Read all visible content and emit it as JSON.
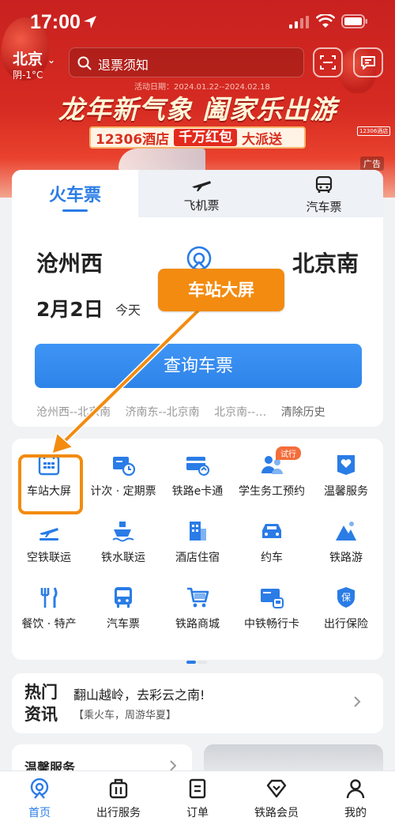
{
  "status_bar": {
    "time": "17:00"
  },
  "header": {
    "city": "北京",
    "weather": "阴-1°C",
    "search_text": "退票须知"
  },
  "banner": {
    "activity_date": "活动日期：2024.01.22--2024.02.18",
    "slogan": "龙年新气象 阖家乐出游",
    "promo_part1": "12306酒店",
    "promo_part2": "千万红包",
    "promo_part3": "大派送",
    "hotel_tag": "12306酒店",
    "ad_tag": "广告"
  },
  "ticket": {
    "tabs": [
      {
        "label": "火车票"
      },
      {
        "label": "飞机票"
      },
      {
        "label": "汽车票"
      }
    ],
    "from": "沧州西",
    "to": "北京南",
    "date": "2月2日",
    "date_relative": "今天",
    "query_button": "查询车票",
    "history": [
      "沧州西--北京南",
      "济南东--北京南",
      "北京南--…"
    ],
    "clear_history": "清除历史"
  },
  "callout": {
    "text": "车站大屏"
  },
  "services": [
    {
      "label": "车站大屏",
      "icon": "calendar-grid-icon"
    },
    {
      "label": "计次 · 定期票",
      "icon": "ticket-clock-icon"
    },
    {
      "label": "铁路e卡通",
      "icon": "card-icon"
    },
    {
      "label": "学生务工预约",
      "icon": "people-icon",
      "badge": "试行"
    },
    {
      "label": "温馨服务",
      "icon": "heart-icon"
    },
    {
      "label": "空铁联运",
      "icon": "plane-train-icon"
    },
    {
      "label": "铁水联运",
      "icon": "ship-icon"
    },
    {
      "label": "酒店住宿",
      "icon": "hotel-icon"
    },
    {
      "label": "约车",
      "icon": "car-icon"
    },
    {
      "label": "铁路游",
      "icon": "mountain-icon"
    },
    {
      "label": "餐饮 · 特产",
      "icon": "cutlery-icon"
    },
    {
      "label": "汽车票",
      "icon": "bus-icon"
    },
    {
      "label": "铁路商城",
      "icon": "cart-icon"
    },
    {
      "label": "中铁畅行卡",
      "icon": "rail-card-icon"
    },
    {
      "label": "出行保险",
      "icon": "shield-icon"
    }
  ],
  "news": {
    "tag_line1": "热门",
    "tag_line2": "资讯",
    "title": "翻山越岭，去彩云之南!",
    "subtitle": "【乘火车，周游华夏】"
  },
  "care": {
    "label": "温馨服务"
  },
  "bottom_nav": [
    {
      "label": "首页",
      "active": true
    },
    {
      "label": "出行服务"
    },
    {
      "label": "订单"
    },
    {
      "label": "铁路会员"
    },
    {
      "label": "我的"
    }
  ],
  "colors": {
    "primary": "#2a7ce6",
    "callout": "#f38b10",
    "banner_red": "#d62b22"
  }
}
